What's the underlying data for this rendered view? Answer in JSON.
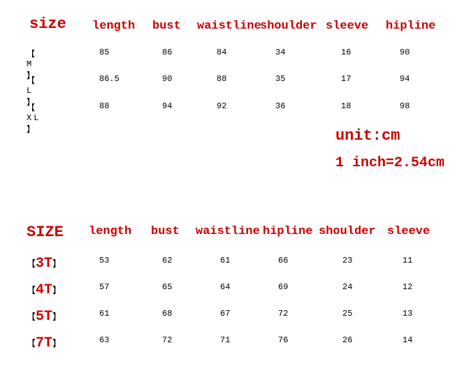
{
  "table1": {
    "size_header": "size",
    "headers": [
      "length",
      "bust",
      "waistline",
      "shoulder",
      "sleeve",
      "hipline"
    ],
    "rows": [
      {
        "size": "【 M 】",
        "values": [
          "85",
          "86",
          "84",
          "34",
          "16",
          "90"
        ]
      },
      {
        "size": "【 L 】",
        "values": [
          "86.5",
          "90",
          "88",
          "35",
          "17",
          "94"
        ]
      },
      {
        "size": "【 XL 】",
        "values": [
          "88",
          "94",
          "92",
          "36",
          "18",
          "98"
        ]
      }
    ]
  },
  "unit": {
    "line1": "unit:cm",
    "line2": "1 inch=2.54cm"
  },
  "table2": {
    "size_header": "SIZE",
    "headers": [
      "length",
      "bust",
      "waistline",
      "hipline",
      "shoulder",
      "sleeve"
    ],
    "rows": [
      {
        "size": "3T",
        "values": [
          "53",
          "62",
          "61",
          "66",
          "23",
          "11"
        ]
      },
      {
        "size": "4T",
        "values": [
          "57",
          "65",
          "64",
          "69",
          "24",
          "12"
        ]
      },
      {
        "size": "5T",
        "values": [
          "61",
          "68",
          "67",
          "72",
          "25",
          "13"
        ]
      },
      {
        "size": "7T",
        "values": [
          "63",
          "72",
          "71",
          "76",
          "26",
          "14"
        ]
      }
    ]
  },
  "brackets": {
    "left": "【",
    "right": "】"
  },
  "chart_data": [
    {
      "type": "table",
      "title": "Adult size chart",
      "columns": [
        "size",
        "length",
        "bust",
        "waistline",
        "shoulder",
        "sleeve",
        "hipline"
      ],
      "rows": [
        [
          "M",
          85,
          86,
          84,
          34,
          16,
          90
        ],
        [
          "L",
          86.5,
          90,
          88,
          35,
          17,
          94
        ],
        [
          "XL",
          88,
          94,
          92,
          36,
          18,
          98
        ]
      ],
      "unit": "cm",
      "note": "1 inch = 2.54 cm"
    },
    {
      "type": "table",
      "title": "Kids size chart",
      "columns": [
        "SIZE",
        "length",
        "bust",
        "waistline",
        "hipline",
        "shoulder",
        "sleeve"
      ],
      "rows": [
        [
          "3T",
          53,
          62,
          61,
          66,
          23,
          11
        ],
        [
          "4T",
          57,
          65,
          64,
          69,
          24,
          12
        ],
        [
          "5T",
          61,
          68,
          67,
          72,
          25,
          13
        ],
        [
          "7T",
          63,
          72,
          71,
          76,
          26,
          14
        ]
      ],
      "unit": "cm"
    }
  ]
}
